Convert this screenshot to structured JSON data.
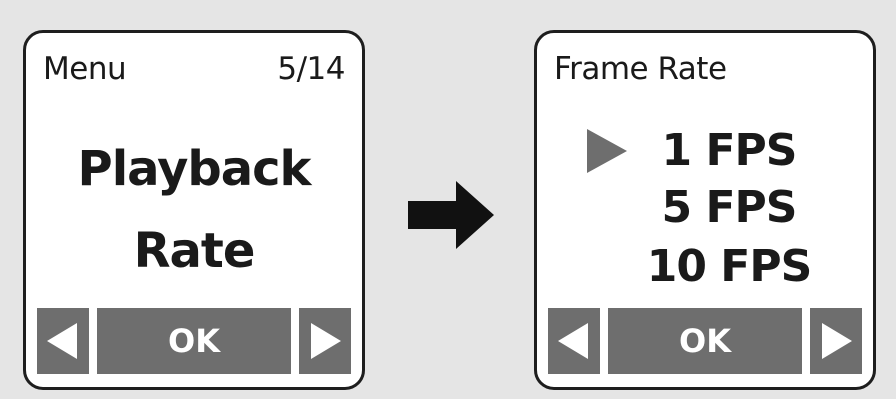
{
  "colors": {
    "background": "#e5e5e5",
    "screen_bg": "#ffffff",
    "border": "#1e1e1e",
    "softkey_bg": "#6e6e6e",
    "softkey_fg": "#ffffff",
    "cursor": "#6e6e6e",
    "arrow": "#111111"
  },
  "left_screen": {
    "title": "Menu",
    "counter": "5/14",
    "item_line1": "Playback",
    "item_line2": "Rate",
    "softkeys": {
      "left_icon": "left-triangle-icon",
      "ok_label": "OK",
      "right_icon": "right-triangle-icon"
    }
  },
  "transition_icon": "right-arrow-icon",
  "right_screen": {
    "title": "Frame Rate",
    "selected_index": 0,
    "cursor_icon": "selection-cursor-icon",
    "options": [
      "1 FPS",
      "5 FPS",
      "10 FPS"
    ],
    "softkeys": {
      "left_icon": "left-triangle-icon",
      "ok_label": "OK",
      "right_icon": "right-triangle-icon"
    }
  }
}
